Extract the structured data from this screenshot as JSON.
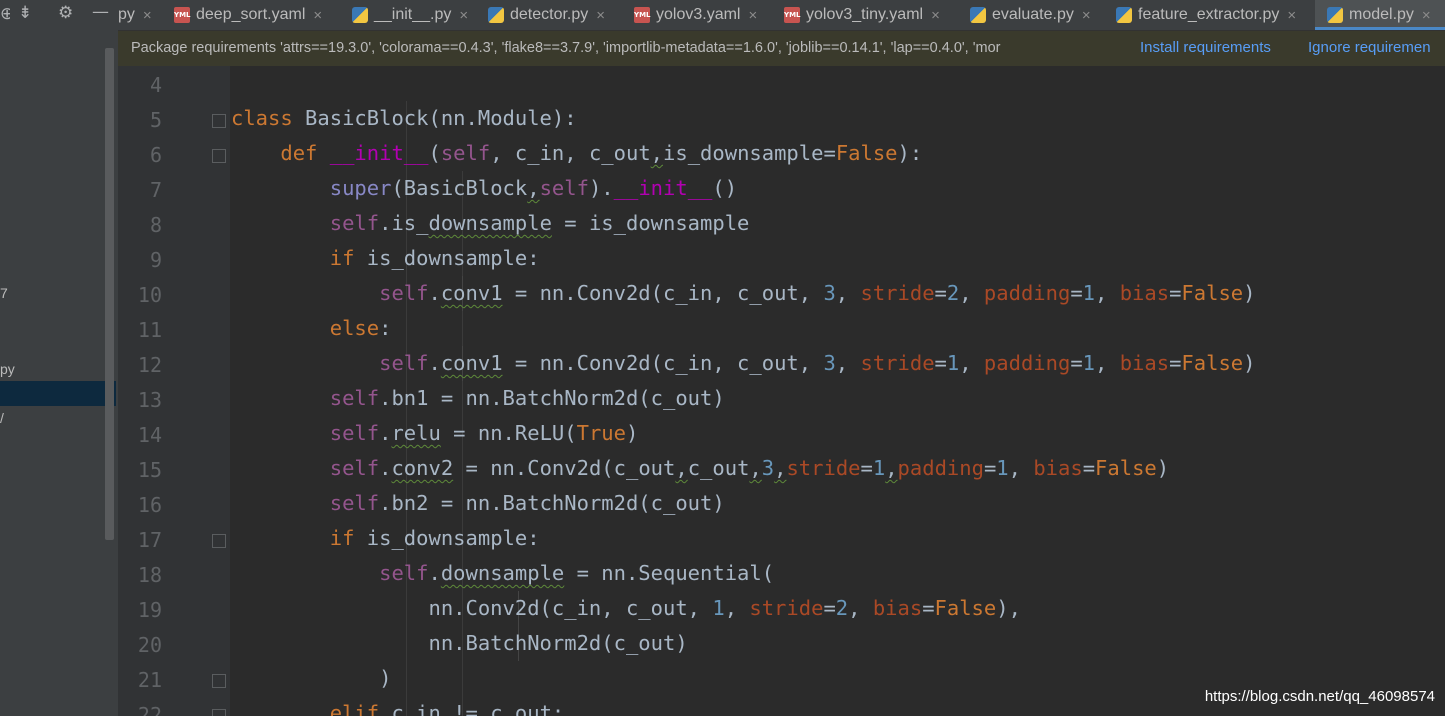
{
  "toolbar": {
    "icons": [
      "globe-icon",
      "collapse-icon",
      "gear-icon",
      "minimize-icon"
    ]
  },
  "tabs": [
    {
      "label": "py",
      "icon": "python-file-icon",
      "partial": true
    },
    {
      "label": "deep_sort.yaml",
      "icon": "yaml-file-icon"
    },
    {
      "label": "__init__.py",
      "icon": "python-file-icon"
    },
    {
      "label": "detector.py",
      "icon": "python-file-icon"
    },
    {
      "label": "yolov3.yaml",
      "icon": "yaml-file-icon"
    },
    {
      "label": "yolov3_tiny.yaml",
      "icon": "yaml-file-icon"
    },
    {
      "label": "evaluate.py",
      "icon": "python-file-icon"
    },
    {
      "label": "feature_extractor.py",
      "icon": "python-file-icon"
    },
    {
      "label": "model.py",
      "icon": "python-file-icon",
      "active": true
    }
  ],
  "tab_close_glyph": "×",
  "yaml_badge": "YML",
  "banner": {
    "message": "Package requirements 'attrs==19.3.0', 'colorama==0.4.3', 'flake8==3.7.9', 'importlib-metadata==1.6.0', 'joblib==0.14.1', 'lap==0.4.0', 'mor",
    "install_link": "Install requirements",
    "ignore_link": "Ignore requiremen"
  },
  "left_panel": {
    "items": [
      "7",
      "py",
      "/"
    ]
  },
  "editor": {
    "line_numbers": [
      "4",
      "5",
      "6",
      "7",
      "8",
      "9",
      "10",
      "11",
      "12",
      "13",
      "14",
      "15",
      "16",
      "17",
      "18",
      "19",
      "20",
      "21",
      "22"
    ]
  },
  "watermark": "https://blog.csdn.net/qq_46098574",
  "colors": {
    "keyword": "#cc7832",
    "self": "#94558d",
    "number": "#6897bb",
    "kwarg": "#aa4926",
    "dunder": "#b200b2",
    "text": "#a9b7c6",
    "link": "#589df6"
  }
}
